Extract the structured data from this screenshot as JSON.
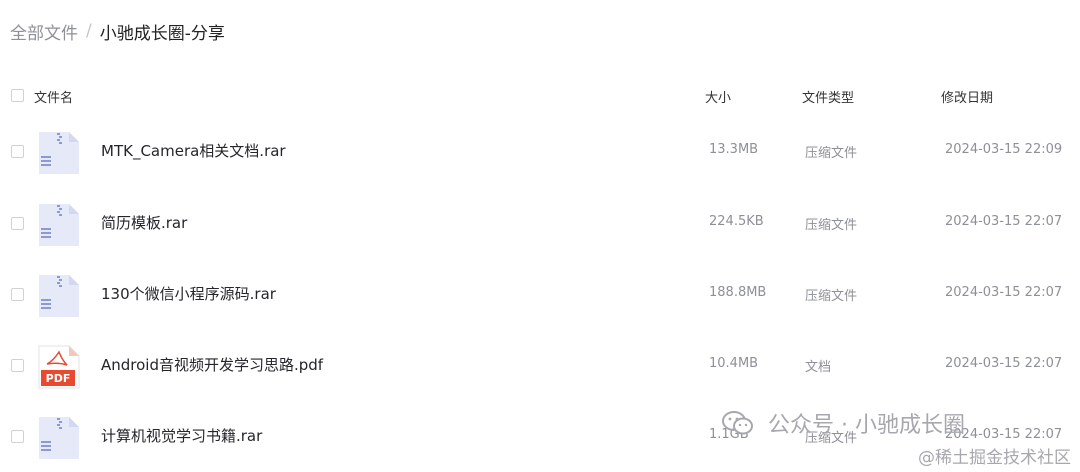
{
  "breadcrumb": {
    "root": "全部文件",
    "separator": "/",
    "current": "小驰成长圈-分享"
  },
  "table": {
    "headers": {
      "name": "文件名",
      "size": "大小",
      "type": "文件类型",
      "modified": "修改日期"
    },
    "rows": [
      {
        "name": "MTK_Camera相关文档.rar",
        "size": "13.3MB",
        "type": "压缩文件",
        "modified": "2024-03-15 22:09",
        "icon": "archive-icon"
      },
      {
        "name": "简历模板.rar",
        "size": "224.5KB",
        "type": "压缩文件",
        "modified": "2024-03-15 22:07",
        "icon": "archive-icon"
      },
      {
        "name": "130个微信小程序源码.rar",
        "size": "188.8MB",
        "type": "压缩文件",
        "modified": "2024-03-15 22:07",
        "icon": "archive-icon"
      },
      {
        "name": "Android音视频开发学习思路.pdf",
        "size": "10.4MB",
        "type": "文档",
        "modified": "2024-03-15 22:07",
        "icon": "pdf-icon"
      },
      {
        "name": "计算机视觉学习书籍.rar",
        "size": "1.1GB",
        "type": "压缩文件",
        "modified": "2024-03-15 22:07",
        "icon": "archive-icon"
      }
    ]
  },
  "watermark": {
    "primary": "公众号 · 小驰成长圈",
    "secondary": "@稀土掘金技术社区",
    "icon": "wechat-icon"
  },
  "colors": {
    "archive_icon": "#e6e9f8",
    "archive_icon_accent": "#8d98d6",
    "pdf_icon": "#e84a2f",
    "muted_text": "#8e9097"
  }
}
